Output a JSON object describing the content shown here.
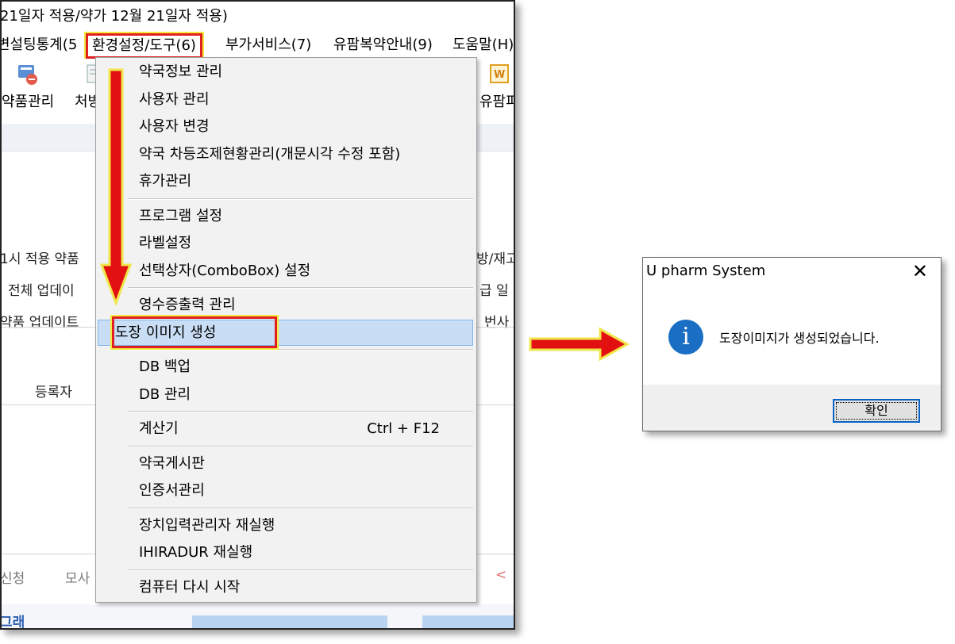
{
  "app": {
    "title": "21일자 적용/약가 12월 21일자 적용)",
    "menu": [
      "변설팅통계(5",
      "환경설정/도구(6)",
      "부가서비스(7)",
      "유팜복약안내(9)",
      "도움말(H)"
    ],
    "toolbar": [
      "약품관리",
      "처방",
      "유팜퍼"
    ],
    "background_texts": {
      "left_row1": "1시 적용 약품",
      "left_row2": "전체 업데이",
      "left_row3": "약품 업데이트",
      "right_row1": "방/재고",
      "right_row2": "급 일",
      "right_row3": "번사",
      "column_header": "등록자",
      "bottom_tab1": "신청",
      "bottom_tab2": "모사",
      "bottom_left": "그래",
      "chevron": "<"
    }
  },
  "dropdown": {
    "groups": [
      [
        {
          "label": "약국정보 관리"
        },
        {
          "label": "사용자 관리"
        },
        {
          "label": "사용자 변경"
        },
        {
          "label": "약국 차등조제현황관리(개문시각 수정 포함)"
        },
        {
          "label": "휴가관리"
        }
      ],
      [
        {
          "label": "프로그램 설정"
        },
        {
          "label": "라벨설정"
        },
        {
          "label": "선택상자(ComboBox) 설정"
        }
      ],
      [
        {
          "label": "영수증출력 관리"
        },
        {
          "label": "도장 이미지 생성",
          "selected": true
        }
      ],
      [
        {
          "label": "DB 백업"
        },
        {
          "label": "DB 관리"
        }
      ],
      [
        {
          "label": "계산기",
          "shortcut": "Ctrl + F12"
        }
      ],
      [
        {
          "label": "약국게시판"
        },
        {
          "label": "인증서관리"
        }
      ],
      [
        {
          "label": "장치입력관리자 재실행"
        },
        {
          "label": "IHIRADUR 재실행"
        }
      ],
      [
        {
          "label": "컴퓨터 다시 시작"
        }
      ]
    ]
  },
  "dialog": {
    "title": "U pharm System",
    "close_glyph": "✕",
    "icon": "information-icon",
    "icon_glyph": "i",
    "message": "도장이미지가 생성되었습니다.",
    "ok_label": "확인"
  },
  "colors": {
    "highlight_border": "#e02020",
    "highlight_glow": "#f4ea40",
    "selection_bg": "#c9def5",
    "info_blue": "#1a6fc4"
  }
}
